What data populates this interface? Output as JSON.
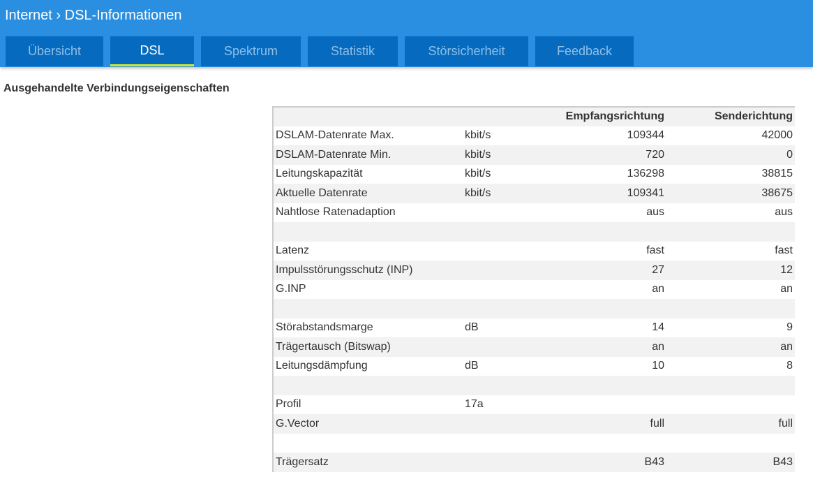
{
  "breadcrumb": {
    "parent": "Internet",
    "separator": "›",
    "current": "DSL-Informationen"
  },
  "tabs": [
    {
      "label": "Übersicht"
    },
    {
      "label": "DSL",
      "active": true
    },
    {
      "label": "Spektrum"
    },
    {
      "label": "Statistik"
    },
    {
      "label": "Störsicherheit"
    },
    {
      "label": "Feedback"
    }
  ],
  "section_title": "Ausgehandelte Verbindungseigenschaften",
  "table": {
    "headers": [
      "",
      "",
      "Empfangsrichtung",
      "Senderichtung"
    ],
    "rows": [
      [
        "DSLAM-Datenrate Max.",
        "kbit/s",
        "109344",
        "42000"
      ],
      [
        "DSLAM-Datenrate Min.",
        "kbit/s",
        "720",
        "0"
      ],
      [
        "Leitungskapazität",
        "kbit/s",
        "136298",
        "38815"
      ],
      [
        "Aktuelle Datenrate",
        "kbit/s",
        "109341",
        "38675"
      ],
      [
        "Nahtlose Ratenadaption",
        "",
        "aus",
        "aus"
      ],
      [
        "",
        "",
        "",
        ""
      ],
      [
        "Latenz",
        "",
        "fast",
        "fast"
      ],
      [
        "Impulsstörungsschutz (INP)",
        "",
        "27",
        "12"
      ],
      [
        "G.INP",
        "",
        "an",
        "an"
      ],
      [
        "",
        "",
        "",
        ""
      ],
      [
        "Störabstandsmarge",
        "dB",
        "14",
        "9"
      ],
      [
        "Trägertausch (Bitswap)",
        "",
        "an",
        "an"
      ],
      [
        "Leitungsdämpfung",
        "dB",
        "10",
        "8"
      ],
      [
        "",
        "",
        "",
        ""
      ],
      [
        "Profil",
        "17a",
        "",
        ""
      ],
      [
        "G.Vector",
        "",
        "full",
        "full"
      ],
      [
        "",
        "",
        "",
        ""
      ],
      [
        "Trägersatz",
        "",
        "B43",
        "B43"
      ]
    ]
  }
}
